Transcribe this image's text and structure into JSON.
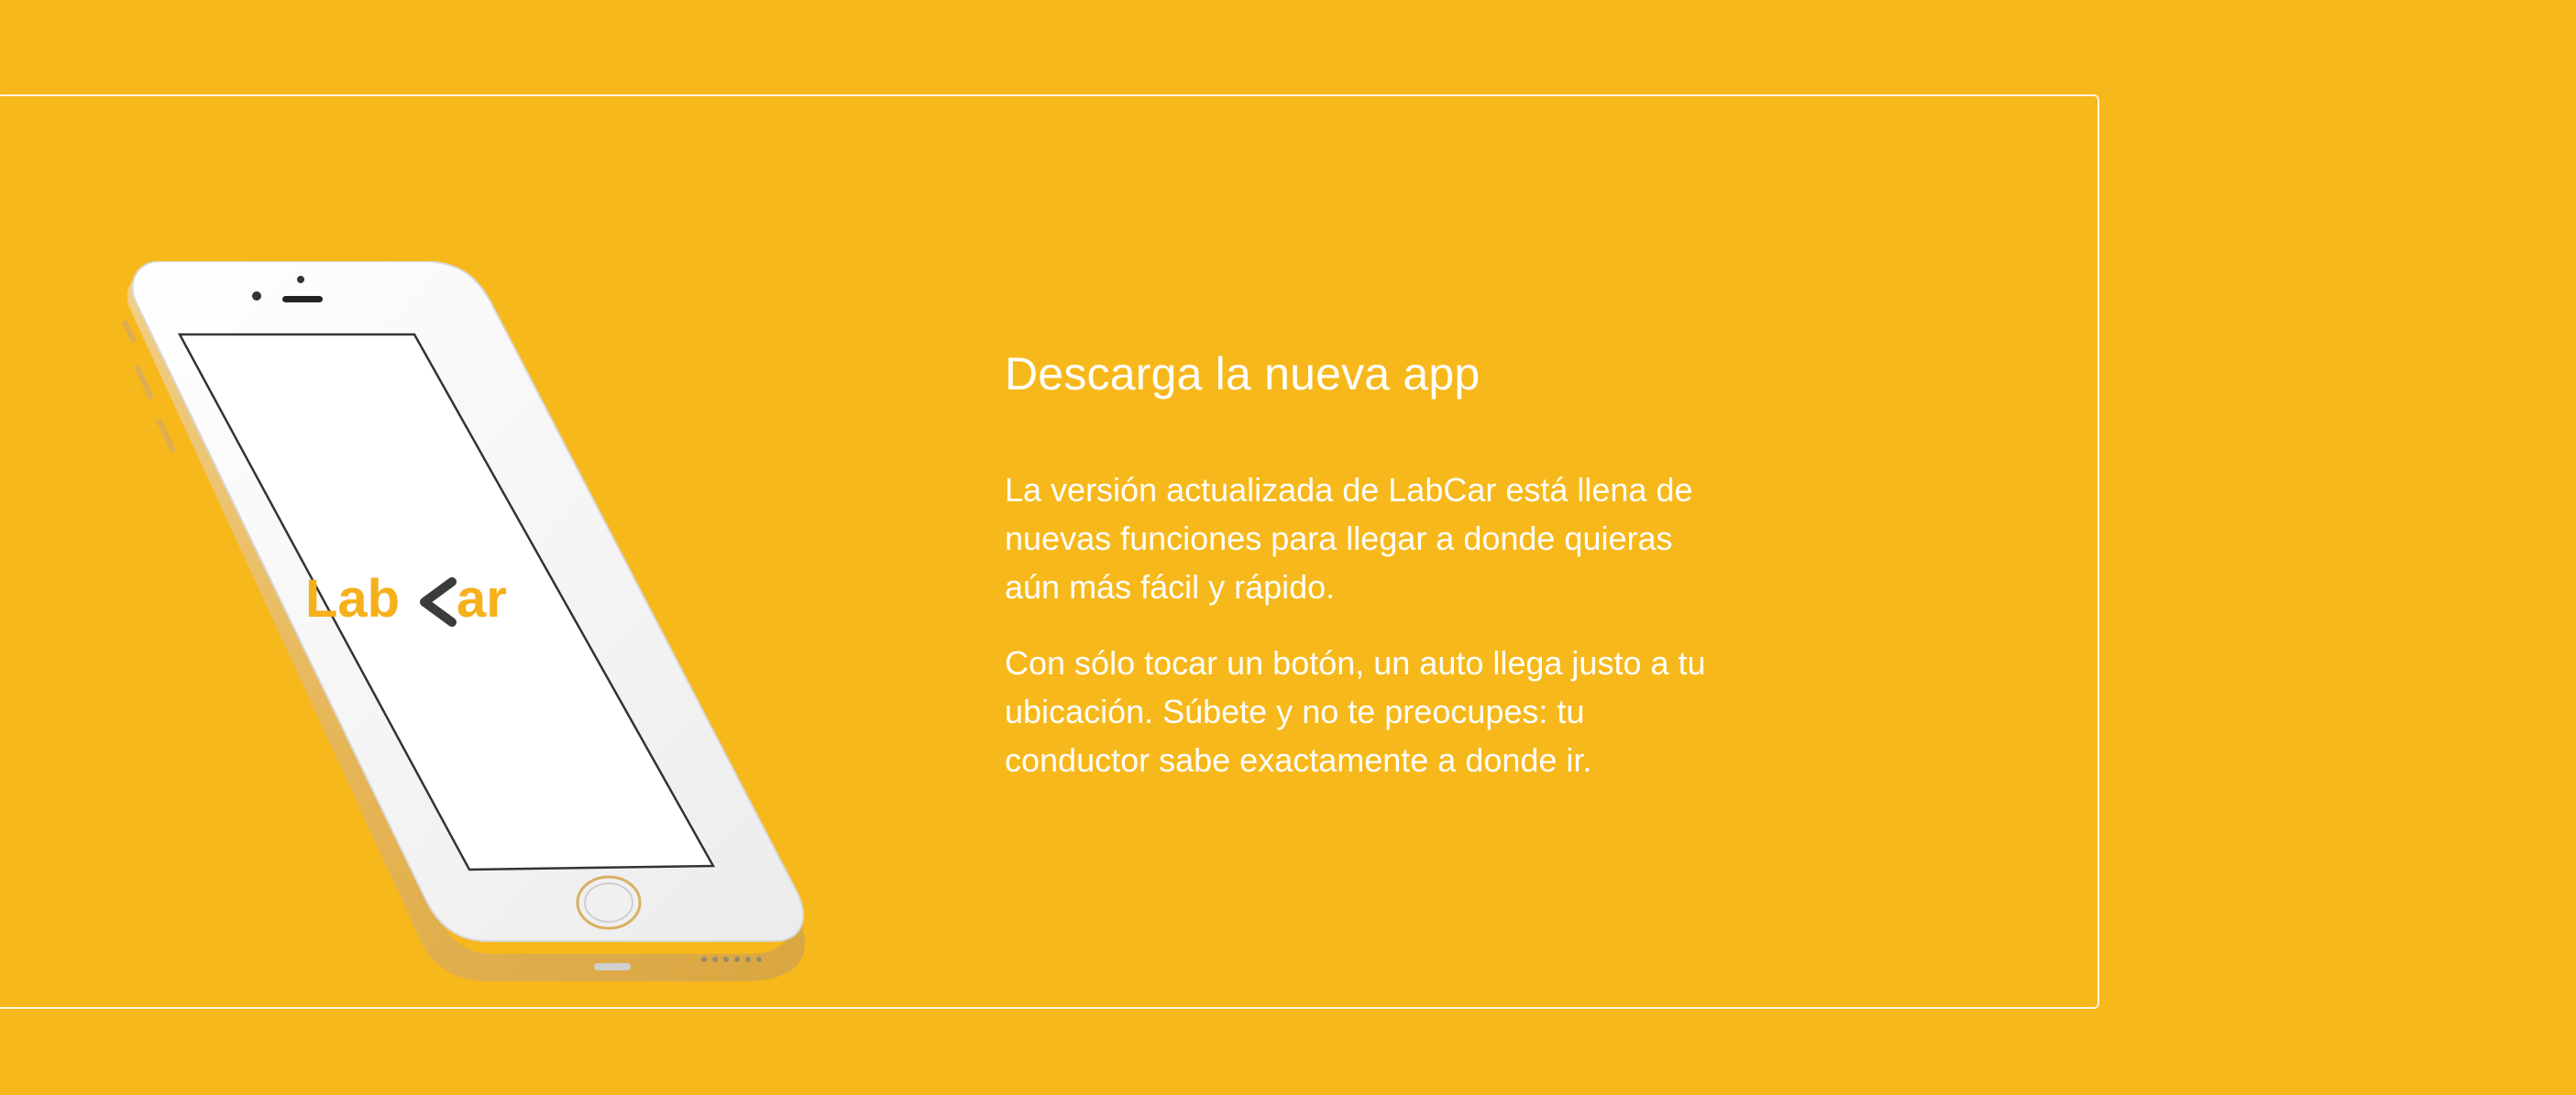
{
  "colors": {
    "background": "#F7B81B",
    "text": "#FFFFFF",
    "card_border": "#FFFFFF",
    "phone_body": "#F4F4F4",
    "phone_frame": "#E9BE62",
    "brand_yellow": "#F5B01A",
    "brand_dark": "#3B3B3B"
  },
  "promo": {
    "heading": "Descarga la nueva app",
    "paragraph_1": "La versión actualizada de LabCar está llena de nuevas funciones para llegar a donde quieras aún más fácil y rápido.",
    "paragraph_2": "Con sólo tocar un botón, un auto llega justo a tu ubicación. Súbete y no te preocupes: tu conductor sabe exactamente a donde ir."
  },
  "phone": {
    "logo_text_left": "Lab",
    "logo_text_right": "ar",
    "icon": "smartphone-mockup"
  }
}
